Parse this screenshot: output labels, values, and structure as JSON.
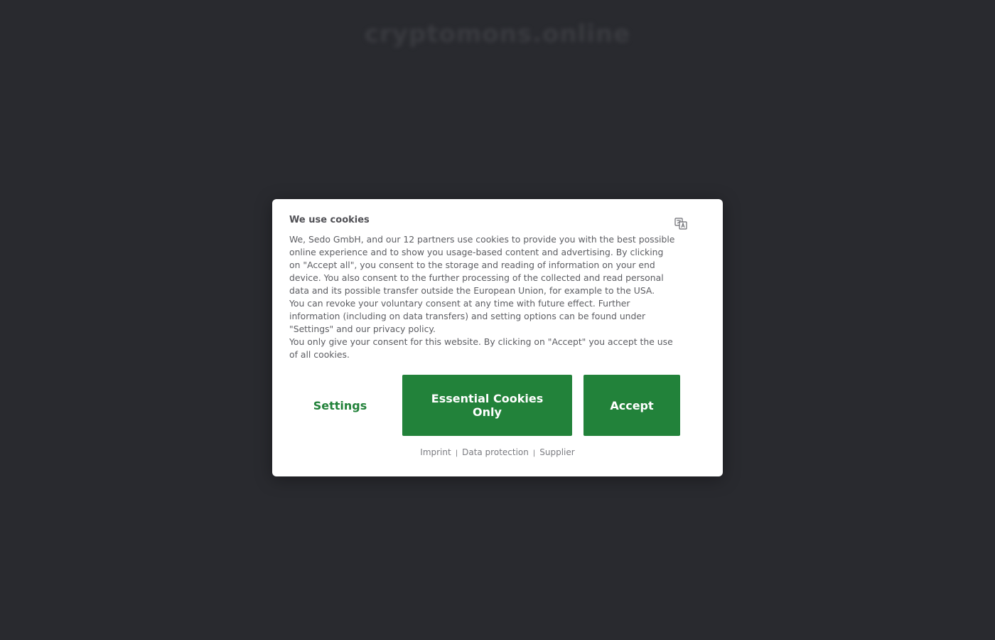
{
  "background": {
    "site_title": "cryptomons.online"
  },
  "colors": {
    "accent": "#22823a",
    "overlay": "#292a2f"
  },
  "modal": {
    "title": "We use cookies",
    "translate_icon": "translate-icon",
    "paragraphs": [
      "We, Sedo GmbH, and our 12 partners use cookies to provide you with the best possible online experience and to show you usage-based content and advertising. By clicking on \"Accept all\", you consent to the storage and reading of information on your end device. You also consent to the further processing of the collected and read personal data and its possible transfer outside the European Union, for example to the USA.",
      "You can revoke your voluntary consent at any time with future effect. Further information (including on data transfers) and setting options can be found under \"Settings\" and our privacy policy.",
      "You only give your consent for this website. By clicking on \"Accept\" you accept the use of all cookies."
    ],
    "buttons": {
      "settings": "Settings",
      "essential": "Essential Cookies Only",
      "accept": "Accept"
    },
    "links": {
      "imprint": "Imprint",
      "data_protection": "Data protection",
      "supplier": "Supplier",
      "separator": "|"
    }
  }
}
